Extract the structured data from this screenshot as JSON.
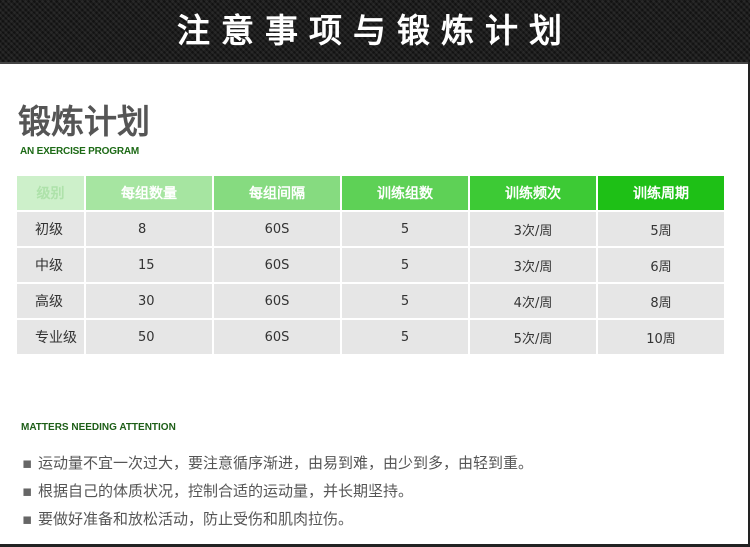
{
  "banner": {
    "title": "注意事项与锻炼计划"
  },
  "section": {
    "title": "锻炼计划",
    "subtitle": "AN EXERCISE PROGRAM"
  },
  "table": {
    "headers": [
      "级别",
      "每组数量",
      "每组间隔",
      "训练组数",
      "训练频次",
      "训练周期"
    ],
    "rows": [
      [
        "初级",
        "8",
        "60S",
        "5",
        "3次/周",
        "5周"
      ],
      [
        "中级",
        "15",
        "60S",
        "5",
        "3次/周",
        "6周"
      ],
      [
        "高级",
        "30",
        "60S",
        "5",
        "4次/周",
        "8周"
      ],
      [
        "专业级",
        "50",
        "60S",
        "5",
        "5次/周",
        "10周"
      ]
    ]
  },
  "attention": {
    "title": "MATTERS NEEDING ATTENTION",
    "items": [
      "运动量不宜一次过大，要注意循序渐进，由易到难，由少到多，由轻到重。",
      "根据自己的体质状况，控制合适的运动量，并长期坚持。",
      "要做好准备和放松活动，防止受伤和肌肉拉伤。"
    ]
  },
  "colors": {
    "banner_bg": "#1c1c1c",
    "accent_green": "#22c21c",
    "heading_green": "#1d6a16",
    "row_bg": "#e6e6e6"
  }
}
